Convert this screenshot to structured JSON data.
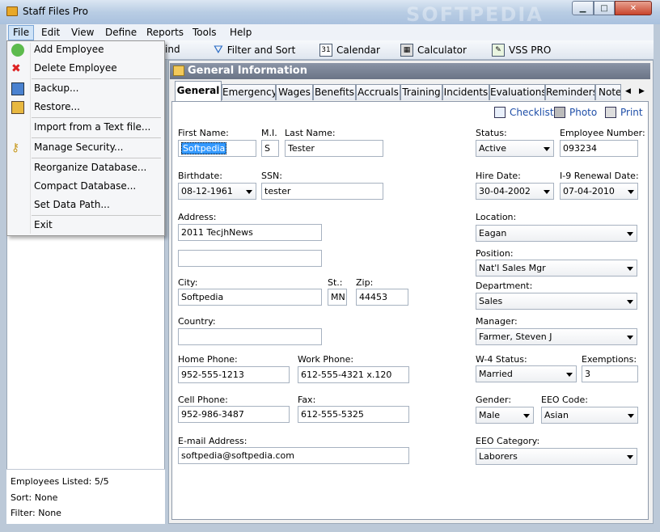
{
  "window": {
    "title": "Staff Files Pro",
    "watermark": "SOFTPEDIA"
  },
  "menubar": [
    "File",
    "Edit",
    "View",
    "Define",
    "Reports",
    "Tools",
    "Help"
  ],
  "file_menu": {
    "items": [
      {
        "label": "Add Employee",
        "icon": "add-employee-icon"
      },
      {
        "label": "Delete Employee",
        "icon": "delete-employee-icon"
      },
      {
        "label": "Backup...",
        "icon": "backup-icon"
      },
      {
        "label": "Restore...",
        "icon": "restore-icon"
      },
      {
        "label": "Import from a Text file..."
      },
      {
        "label": "Manage Security...",
        "icon": "key-icon"
      },
      {
        "label": "Reorganize Database..."
      },
      {
        "label": "Compact Database..."
      },
      {
        "label": "Set Data Path..."
      },
      {
        "label": "Exit"
      }
    ]
  },
  "toolbar": {
    "find_partial": "ind",
    "filter_sort": "Filter and Sort",
    "calendar": "Calendar",
    "calculator": "Calculator",
    "vss_pro": "VSS PRO"
  },
  "status": {
    "employees_listed": "Employees Listed: 5/5",
    "sort": "Sort: None",
    "filter": "Filter: None"
  },
  "section": {
    "title": "General Information"
  },
  "tabs": [
    "General",
    "Emergency",
    "Wages",
    "Benefits",
    "Accruals",
    "Training",
    "Incidents",
    "Evaluations",
    "Reminders",
    "Notes"
  ],
  "actions": {
    "checklist": "Checklist",
    "photo": "Photo",
    "print": "Print"
  },
  "form": {
    "labels": {
      "first_name": "First Name:",
      "mi": "M.I.",
      "last_name": "Last Name:",
      "birthdate": "Birthdate:",
      "ssn": "SSN:",
      "address": "Address:",
      "city": "City:",
      "st": "St.:",
      "zip": "Zip:",
      "country": "Country:",
      "home_phone": "Home Phone:",
      "work_phone": "Work Phone:",
      "cell_phone": "Cell Phone:",
      "fax": "Fax:",
      "email": "E-mail Address:",
      "status": "Status:",
      "employee_number": "Employee Number:",
      "hire_date": "Hire Date:",
      "i9_renewal": "I-9 Renewal Date:",
      "location": "Location:",
      "position": "Position:",
      "department": "Department:",
      "manager": "Manager:",
      "w4_status": "W-4 Status:",
      "exemptions": "Exemptions:",
      "gender": "Gender:",
      "eeo_code": "EEO Code:",
      "eeo_category": "EEO Category:"
    },
    "values": {
      "first_name": "Softpedia",
      "mi": "S",
      "last_name": "Tester",
      "birthdate": "08-12-1961",
      "ssn": "tester",
      "address1": "2011 TecjhNews",
      "address2": "",
      "city": "Softpedia",
      "st": "MN",
      "zip": "44453",
      "country": "",
      "home_phone": "952-555-1213",
      "work_phone": "612-555-4321 x.120",
      "cell_phone": "952-986-3487",
      "fax": "612-555-5325",
      "email": "softpedia@softpedia.com",
      "status": "Active",
      "employee_number": "093234",
      "hire_date": "30-04-2002",
      "i9_renewal": "07-04-2010",
      "location": "Eagan",
      "position": "Nat'l Sales Mgr",
      "department": "Sales",
      "manager": "Farmer, Steven J",
      "w4_status": "Married",
      "exemptions": "3",
      "gender": "Male",
      "eeo_code": "Asian",
      "eeo_category": "Laborers"
    }
  }
}
